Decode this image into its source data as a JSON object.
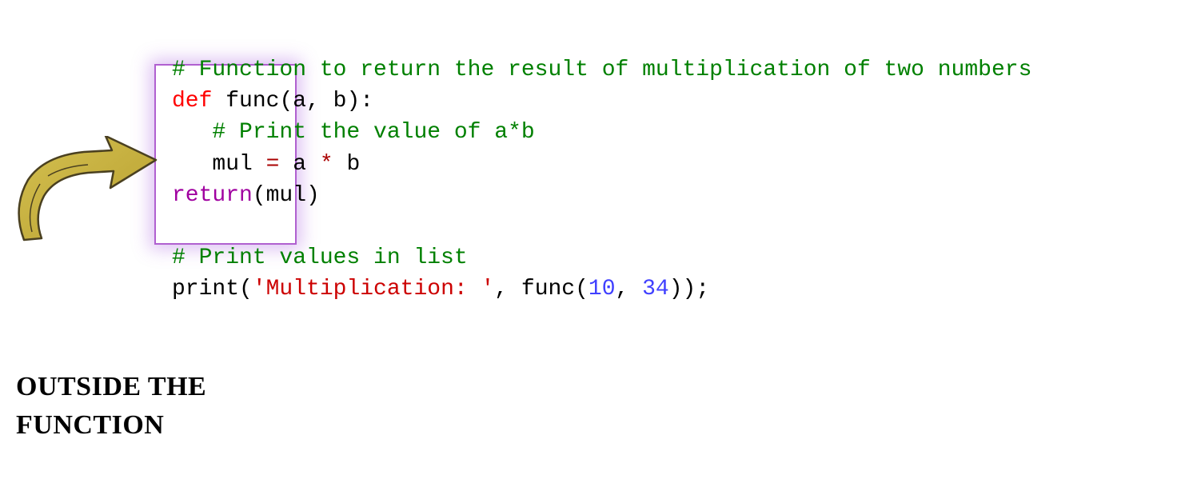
{
  "code": {
    "line1_comment": "# Function to return the result of multiplication of two numbers",
    "line2_def": "def",
    "line2_func": " func",
    "line2_params": "(a, b):",
    "line3_comment": "   # Print the value of a*b",
    "line4_indent": "   mul ",
    "line4_eq": "=",
    "line4_rest": " a ",
    "line4_star": "*",
    "line4_b": " b",
    "line5_return": "return",
    "line5_rest": "(mul)",
    "line7_comment": "# Print values in list",
    "line8_print": "print",
    "line8_open": "(",
    "line8_string": "'Multiplication: '",
    "line8_comma": ", func(",
    "line8_num1": "10",
    "line8_mid": ", ",
    "line8_num2": "34",
    "line8_close": "));"
  },
  "annotation": {
    "line1": "OUTSIDE THE",
    "line2": "FUNCTION"
  }
}
